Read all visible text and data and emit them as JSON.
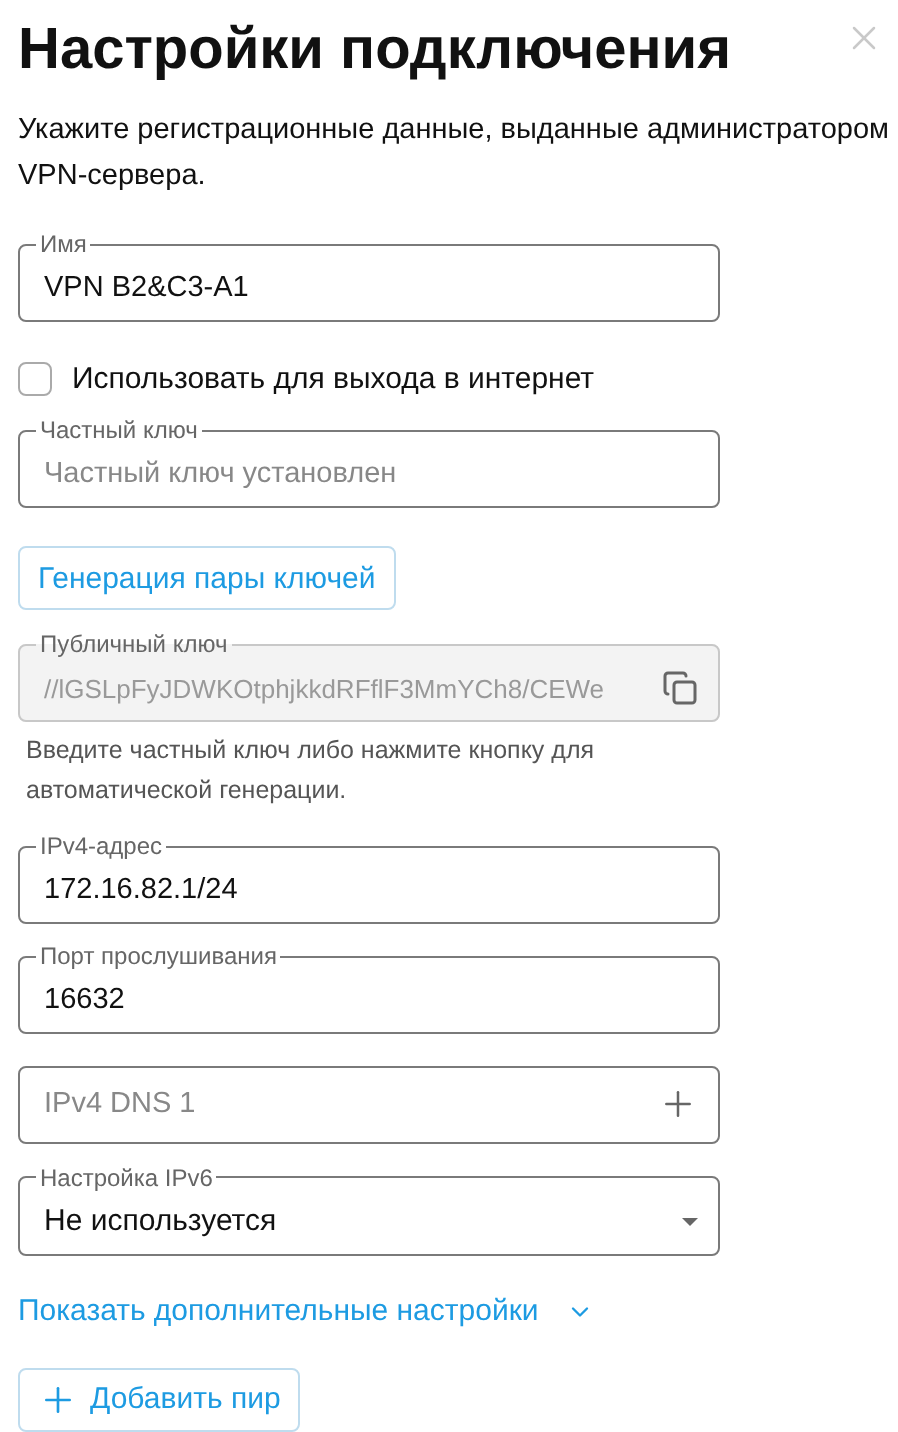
{
  "dialog": {
    "title": "Настройки подключения",
    "subtitle": "Укажите регистрационные данные, выданные администратором VPN-сервера."
  },
  "items": [
    {
      "kind": "text",
      "label": "Имя",
      "value": "VPN B2&C3-A1"
    },
    {
      "kind": "checkbox",
      "label": "Использовать для выхода в интернет",
      "checked": false
    },
    {
      "kind": "text",
      "label": "Частный ключ",
      "placeholder": "Частный ключ установлен"
    },
    {
      "kind": "button",
      "label": "Генерация пары ключей"
    },
    {
      "kind": "copy-field",
      "label": "Публичный ключ",
      "value": "//lGSLpFyJDWKOtphjkkdRFflF3MmYCh8/CEWe",
      "disabled": true,
      "helper": "Введите частный ключ либо нажмите кнопку для автоматической генерации."
    },
    {
      "kind": "text",
      "label": "IPv4-адрес",
      "value": "172.16.82.1/24"
    },
    {
      "kind": "text",
      "label": "Порт прослушивания",
      "value": "16632"
    },
    {
      "kind": "add-field",
      "placeholder": "IPv4 DNS 1"
    },
    {
      "kind": "select",
      "label": "Настройка IPv6",
      "value": "Не используется"
    },
    {
      "kind": "link",
      "label": "Показать дополнительные настройки",
      "expanded": false
    },
    {
      "kind": "add-button",
      "label": "Добавить пир"
    }
  ]
}
